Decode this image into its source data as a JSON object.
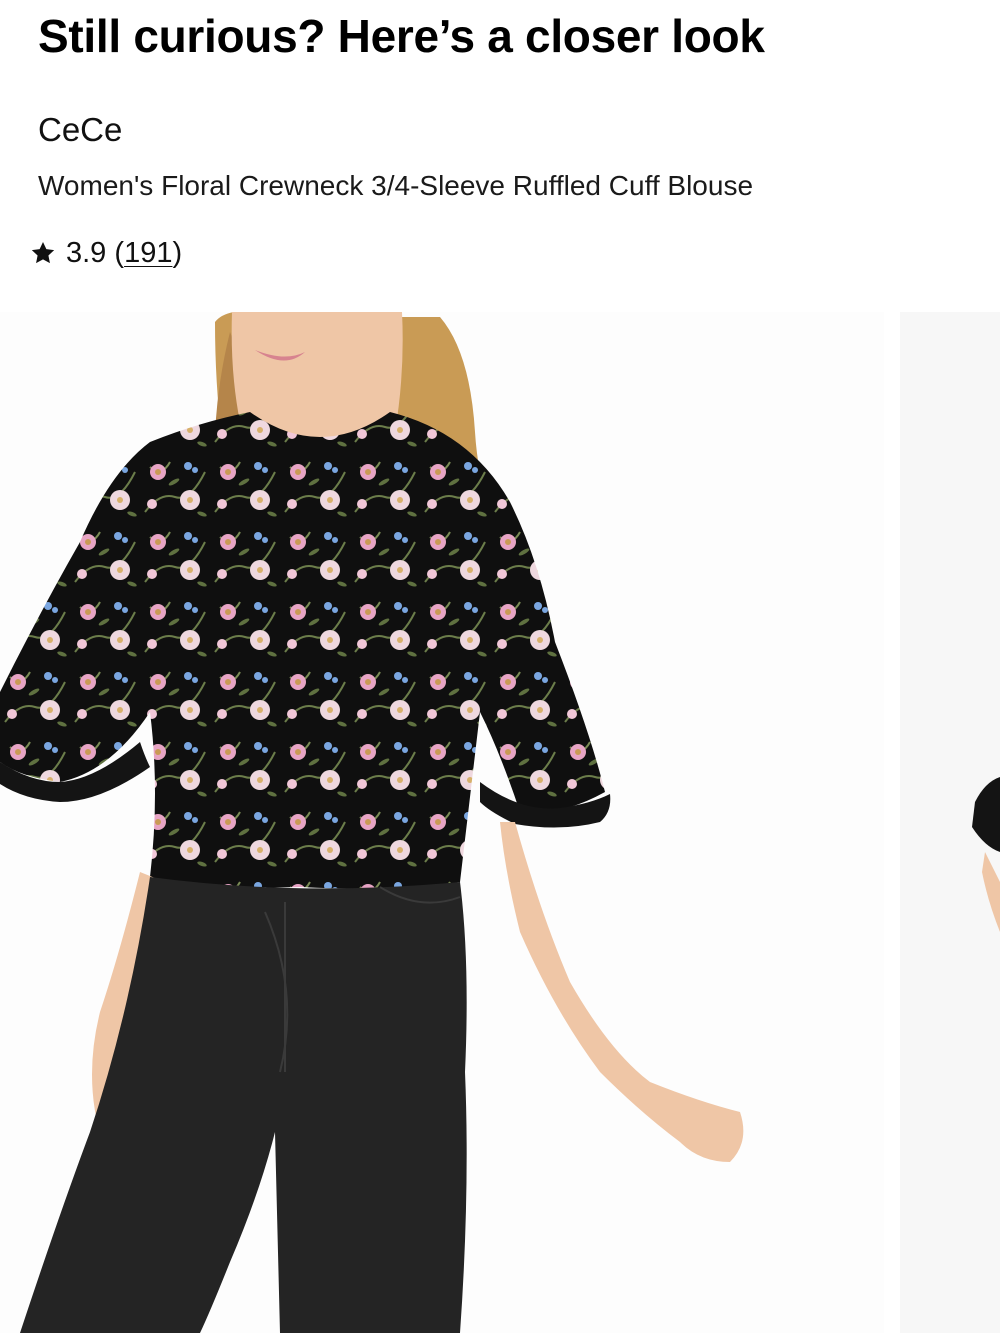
{
  "section": {
    "heading": "Still curious? Here’s a closer look"
  },
  "product": {
    "brand": "CeCe",
    "title": "Women's Floral Crewneck 3/4-Sleeve Ruffled Cuff Blouse",
    "rating": {
      "value": "3.9",
      "count": "191",
      "icon": "star-icon"
    }
  },
  "carousel": {
    "slides": [
      {
        "alt": "product-photo-main"
      },
      {
        "alt": "product-photo-next"
      }
    ]
  },
  "colors": {
    "text": "#111111",
    "background": "#ffffff",
    "blouse": "#111111",
    "jeans": "#242424",
    "hair": "#c99b55",
    "skin": "#efc6a6"
  }
}
